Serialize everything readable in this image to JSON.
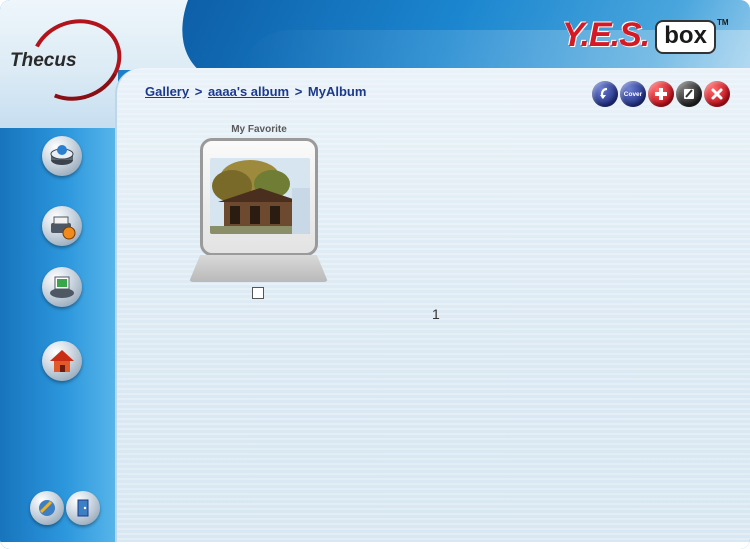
{
  "header": {
    "logo_text": "Thecus",
    "brand_yes": "Y.E.S.",
    "brand_box": "box",
    "brand_tm": "TM"
  },
  "breadcrumb": {
    "items": [
      "Gallery",
      "aaaa's album"
    ],
    "current": "MyAlbum",
    "separator": ">"
  },
  "toolbar": {
    "back_icon": "back-arrow-icon",
    "cover_label": "Cover",
    "add_icon": "plus-icon",
    "edit_icon": "pencil-icon",
    "delete_icon": "x-icon"
  },
  "sidebar": {
    "icons": [
      "disk-icon",
      "printer-camera-icon",
      "photo-computer-icon",
      "home-icon",
      "settings-icon",
      "logout-door-icon"
    ]
  },
  "album": {
    "title": "My Favorite",
    "selected": false
  },
  "pagination": {
    "current_page": "1"
  },
  "colors": {
    "sidebar_blue": "#1d80c7",
    "link_blue": "#1c3a8c",
    "brand_red": "#d61a25"
  }
}
